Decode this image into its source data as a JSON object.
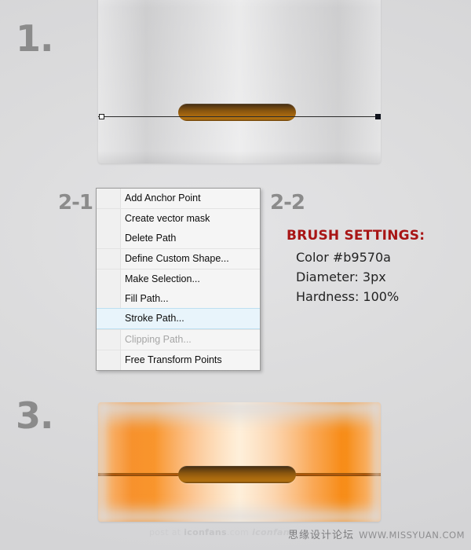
{
  "steps": {
    "one": "1.",
    "two_one": "2-1",
    "two_two": "2-2",
    "three": "3."
  },
  "context_menu": {
    "items": [
      {
        "label": "Add Anchor Point",
        "state": "normal",
        "separator_above": false
      },
      {
        "label": "Create vector mask",
        "state": "normal",
        "separator_above": true
      },
      {
        "label": "Delete Path",
        "state": "normal",
        "separator_above": false
      },
      {
        "label": "Define Custom Shape...",
        "state": "normal",
        "separator_above": true
      },
      {
        "label": "Make Selection...",
        "state": "normal",
        "separator_above": true
      },
      {
        "label": "Fill Path...",
        "state": "normal",
        "separator_above": false
      },
      {
        "label": "Stroke Path...",
        "state": "selected",
        "separator_above": false
      },
      {
        "label": "Clipping Path...",
        "state": "disabled",
        "separator_above": true
      },
      {
        "label": "Free Transform Points",
        "state": "normal",
        "separator_above": true
      }
    ],
    "highlight_color": "#e8f4fb",
    "disabled_color": "#a6a6a6"
  },
  "brush_settings": {
    "title": "BRUSH SETTINGS:",
    "title_color": "#a81515",
    "lines": [
      "Color #b9570a",
      "Diameter: 3px",
      "Hardness: 100%"
    ]
  },
  "artwork": {
    "step1_caption": "orange cylinder with horizontal path and two anchor points",
    "step3_caption": "orange cylinder with stroked brown line across slot",
    "slot_color": "#8a560f",
    "stroke_color": "#b9570a",
    "path_line_color": "#2b2b2b"
  },
  "watermarks": {
    "left_prefix": "post at ",
    "left_brand": "iconfans",
    "left_suffix": ".com",
    "left_logo": "iconfans",
    "right_cn": "思缘设计论坛",
    "right_url": "WWW.MISSYUAN.COM"
  }
}
